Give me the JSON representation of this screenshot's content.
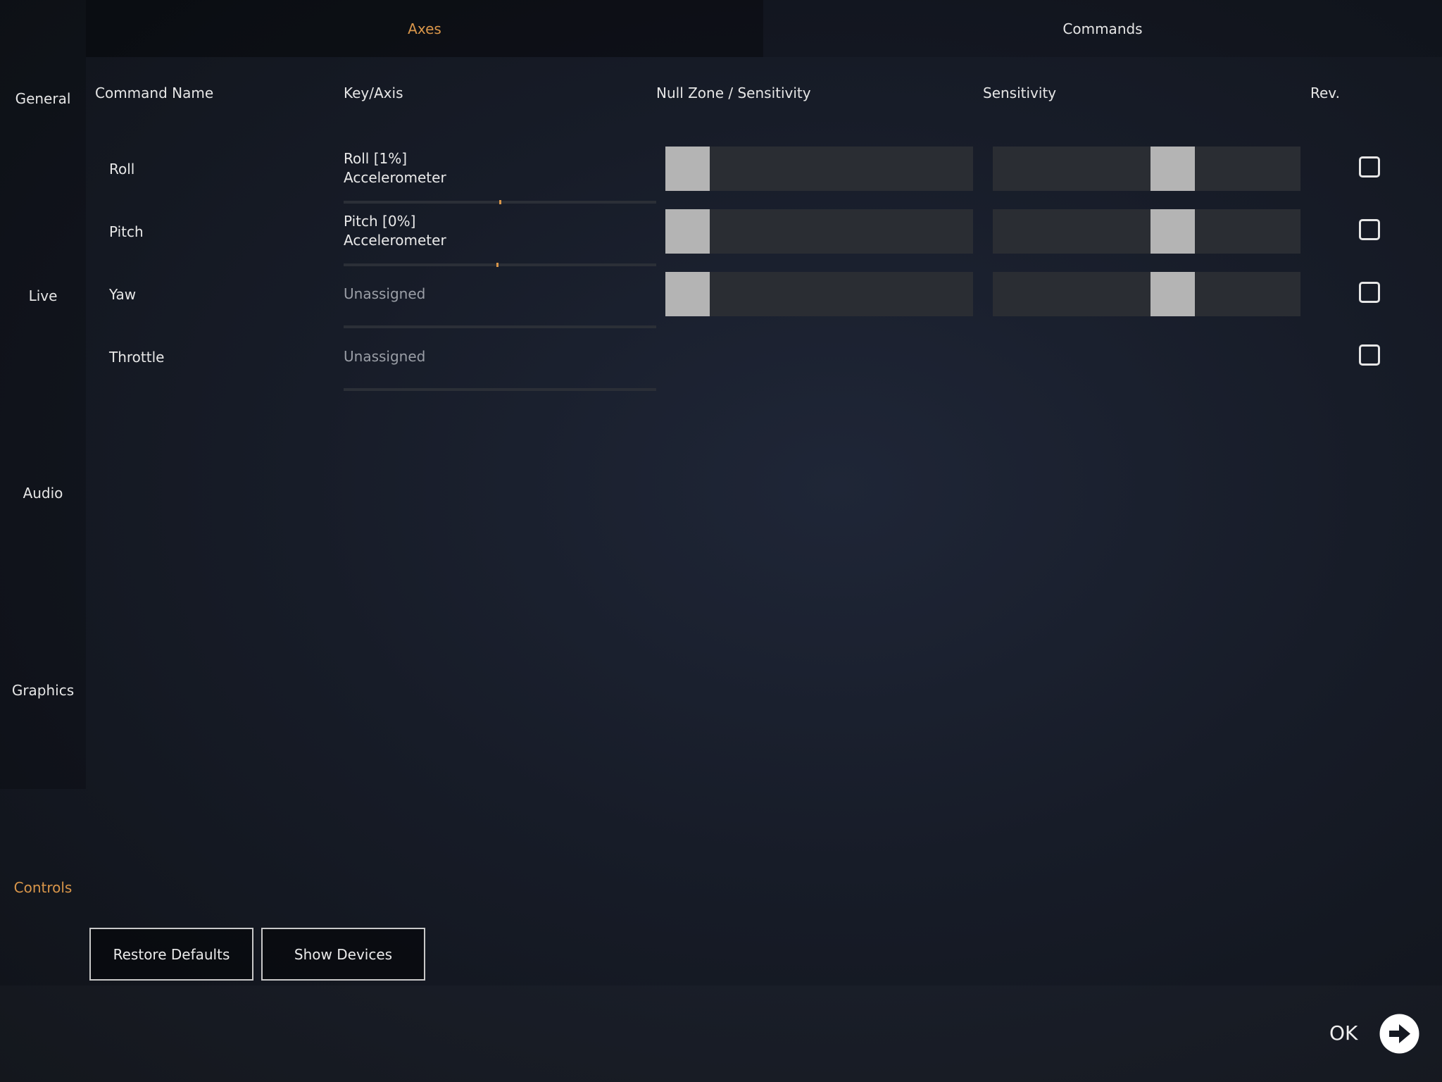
{
  "sidebar": {
    "items": [
      {
        "label": "General"
      },
      {
        "label": "Live"
      },
      {
        "label": "Audio"
      },
      {
        "label": "Graphics"
      },
      {
        "label": "Controls"
      }
    ]
  },
  "tabs": [
    {
      "label": "Axes",
      "active": true
    },
    {
      "label": "Commands",
      "active": false
    }
  ],
  "table": {
    "headers": {
      "command_name": "Command Name",
      "key_axis": "Key/Axis",
      "null_zone": "Null Zone / Sensitivity",
      "sensitivity": "Sensitivity",
      "rev": "Rev."
    },
    "rows": [
      {
        "name": "Roll",
        "key_line1": "Roll [1%]",
        "key_line2": "Accelerometer",
        "axis_value_pct": 50,
        "null_zone_pct": 0,
        "sensitivity_pct": 60,
        "reversed": false
      },
      {
        "name": "Pitch",
        "key_line1": "Pitch [0%]",
        "key_line2": "Accelerometer",
        "axis_value_pct": 49,
        "null_zone_pct": 0,
        "sensitivity_pct": 60,
        "reversed": false
      },
      {
        "name": "Yaw",
        "key_line1": "Unassigned",
        "key_line2": "",
        "null_zone_pct": 0,
        "sensitivity_pct": 60,
        "reversed": false
      },
      {
        "name": "Throttle",
        "key_line1": "Unassigned",
        "key_line2": "",
        "reversed": false
      }
    ]
  },
  "buttons": {
    "restore_defaults": "Restore Defaults",
    "show_devices": "Show Devices"
  },
  "footer": {
    "ok_label": "OK"
  },
  "colors": {
    "accent": "#d9964a",
    "slider_track": "#2a2d33",
    "slider_thumb": "#b4b4b4"
  },
  "icons": {
    "ok": "arrow-right-circle-icon"
  }
}
